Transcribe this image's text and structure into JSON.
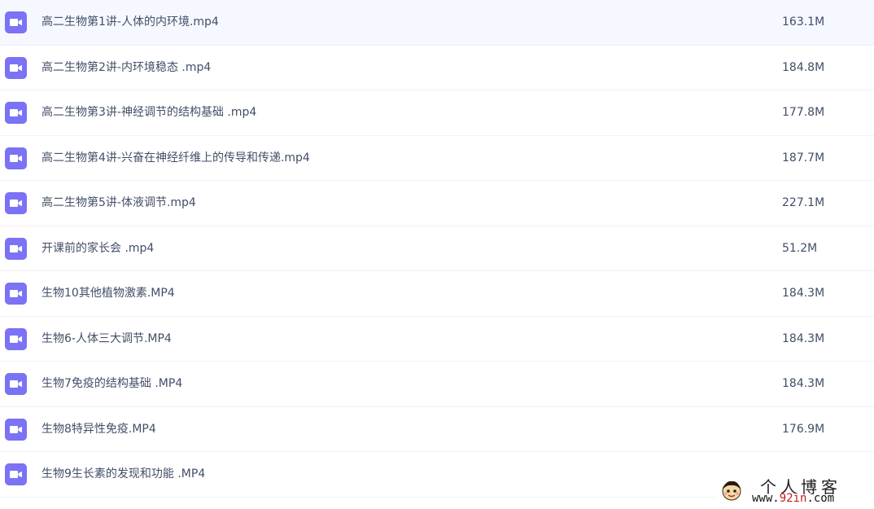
{
  "files": [
    {
      "name": "高二生物第1讲-人体的内环境.mp4",
      "size": "163.1M",
      "icon": "video-icon",
      "selected": true
    },
    {
      "name": "高二生物第2讲-内环境稳态 .mp4",
      "size": "184.8M",
      "icon": "video-icon",
      "selected": false
    },
    {
      "name": "高二生物第3讲-神经调节的结构基础 .mp4",
      "size": "177.8M",
      "icon": "video-icon",
      "selected": false
    },
    {
      "name": "高二生物第4讲-兴奋在神经纤维上的传导和传递.mp4",
      "size": "187.7M",
      "icon": "video-icon",
      "selected": false
    },
    {
      "name": "高二生物第5讲-体液调节.mp4",
      "size": "227.1M",
      "icon": "video-icon",
      "selected": false
    },
    {
      "name": "开课前的家长会 .mp4",
      "size": "51.2M",
      "icon": "video-icon",
      "selected": false
    },
    {
      "name": "生物10其他植物激素.MP4",
      "size": "184.3M",
      "icon": "video-icon",
      "selected": false
    },
    {
      "name": "生物6-人体三大调节.MP4",
      "size": "184.3M",
      "icon": "video-icon",
      "selected": false
    },
    {
      "name": "生物7免疫的结构基础 .MP4",
      "size": "184.3M",
      "icon": "video-icon",
      "selected": false
    },
    {
      "name": "生物8特异性免疫.MP4",
      "size": "176.9M",
      "icon": "video-icon",
      "selected": false
    },
    {
      "name": "生物9生长素的发现和功能 .MP4",
      "size": "",
      "icon": "video-icon",
      "selected": false
    }
  ],
  "watermark": {
    "title": "个人博客",
    "url_prefix": "www.",
    "url_accent": "92in",
    "url_suffix": ".com"
  },
  "colors": {
    "icon": "#7b72f5",
    "text": "#424e67",
    "selected_row": "#f5f8fe",
    "divider": "#f1f2f5"
  }
}
